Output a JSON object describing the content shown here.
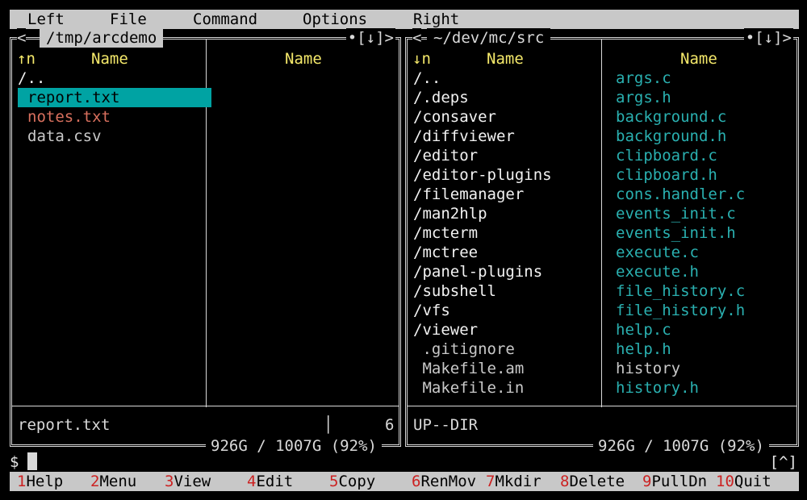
{
  "menu": [
    "Left",
    "File",
    "Command",
    "Options",
    "Right"
  ],
  "left_panel": {
    "path": "/tmp/arcdemo",
    "left_ctrl": "<",
    "right_ctrl": "•[↓]>",
    "sort_indicator": "↑n",
    "col1_header": "Name",
    "col2_header": "Name",
    "col1": [
      {
        "name": "/..",
        "type": "dir"
      },
      {
        "name": "report.txt",
        "type": "selected"
      },
      {
        "name": "notes.txt",
        "type": "mod"
      },
      {
        "name": "data.csv",
        "type": "file"
      }
    ],
    "status_name": "report.txt",
    "status_size": "6",
    "disk": "926G / 1007G (92%)"
  },
  "right_panel": {
    "path": "~/dev/mc/src",
    "left_ctrl": "<",
    "right_ctrl": "•[↓]>",
    "sort_indicator": "↓n",
    "col1_header": "Name",
    "col2_header": "Name",
    "col1": [
      {
        "name": "/..",
        "type": "dir"
      },
      {
        "name": "/.deps",
        "type": "dir"
      },
      {
        "name": "/consaver",
        "type": "dir"
      },
      {
        "name": "/diffviewer",
        "type": "dir"
      },
      {
        "name": "/editor",
        "type": "dir"
      },
      {
        "name": "/editor-plugins",
        "type": "dir"
      },
      {
        "name": "/filemanager",
        "type": "dir"
      },
      {
        "name": "/man2hlp",
        "type": "dir"
      },
      {
        "name": "/mcterm",
        "type": "dir"
      },
      {
        "name": "/mctree",
        "type": "dir"
      },
      {
        "name": "/panel-plugins",
        "type": "dir"
      },
      {
        "name": "/subshell",
        "type": "dir"
      },
      {
        "name": "/vfs",
        "type": "dir"
      },
      {
        "name": "/viewer",
        "type": "dir"
      },
      {
        "name": " .gitignore",
        "type": "file"
      },
      {
        "name": " Makefile.am",
        "type": "file"
      },
      {
        "name": " Makefile.in",
        "type": "file"
      }
    ],
    "col2": [
      {
        "name": "args.c",
        "type": "src"
      },
      {
        "name": "args.h",
        "type": "src"
      },
      {
        "name": "background.c",
        "type": "src"
      },
      {
        "name": "background.h",
        "type": "src"
      },
      {
        "name": "clipboard.c",
        "type": "src"
      },
      {
        "name": "clipboard.h",
        "type": "src"
      },
      {
        "name": "cons.handler.c",
        "type": "src"
      },
      {
        "name": "events_init.c",
        "type": "src"
      },
      {
        "name": "events_init.h",
        "type": "src"
      },
      {
        "name": "execute.c",
        "type": "src"
      },
      {
        "name": "execute.h",
        "type": "src"
      },
      {
        "name": "file_history.c",
        "type": "src"
      },
      {
        "name": "file_history.h",
        "type": "src"
      },
      {
        "name": "help.c",
        "type": "src"
      },
      {
        "name": "help.h",
        "type": "src"
      },
      {
        "name": "history",
        "type": "file"
      },
      {
        "name": "history.h",
        "type": "src"
      }
    ],
    "status_name": "UP--DIR",
    "disk": "926G / 1007G (92%)"
  },
  "command_line": {
    "prompt": "$",
    "right_hint": "[^]"
  },
  "fkeys": [
    {
      "num": "1",
      "label": "Help"
    },
    {
      "num": "2",
      "label": "Menu"
    },
    {
      "num": "3",
      "label": "View"
    },
    {
      "num": "4",
      "label": "Edit"
    },
    {
      "num": "5",
      "label": "Copy"
    },
    {
      "num": "6",
      "label": "RenMov"
    },
    {
      "num": "7",
      "label": "Mkdir"
    },
    {
      "num": "8",
      "label": "Delete"
    },
    {
      "num": "9",
      "label": "PullDn"
    },
    {
      "num": "10",
      "label": "Quit"
    }
  ],
  "colors": {
    "selected": "#00a3a3",
    "header": "#f4e86a",
    "source": "#2ab0b0",
    "modified": "#d9705e",
    "fkey_number": "#cc2222"
  }
}
